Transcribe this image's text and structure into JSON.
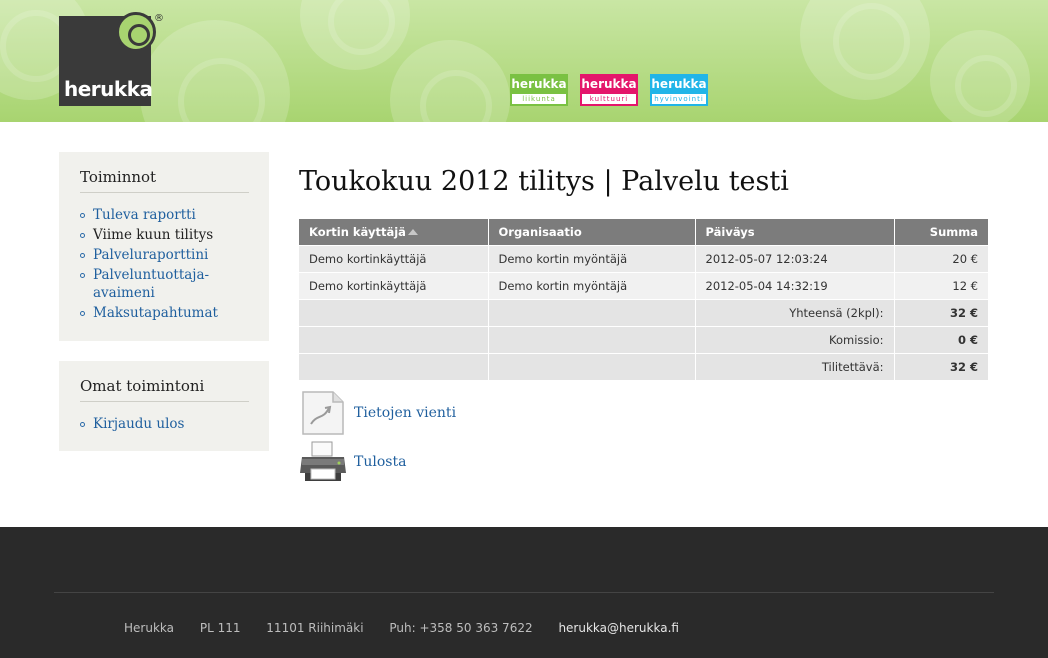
{
  "header": {
    "logo_text": "herukka",
    "logo_reg": "®",
    "brands": [
      {
        "name": "herukka",
        "sub": "liikunta",
        "color": "#7ac142"
      },
      {
        "name": "herukka",
        "sub": "kulttuuri",
        "color": "#e4166b"
      },
      {
        "name": "herukka",
        "sub": "hyvinvointi",
        "color": "#21b5e8"
      }
    ]
  },
  "sidebar": {
    "box1": {
      "title": "Toiminnot",
      "items": [
        {
          "label": "Tuleva raportti"
        },
        {
          "label": "Viime kuun tilitys"
        },
        {
          "label": "Palveluraporttini"
        },
        {
          "label": "Palveluntuottaja-avaimeni"
        },
        {
          "label": "Maksutapahtumat"
        }
      ]
    },
    "box2": {
      "title": "Omat toimintoni",
      "items": [
        {
          "label": "Kirjaudu ulos"
        }
      ]
    }
  },
  "main": {
    "title": "Toukokuu 2012 tilitys | Palvelu testi",
    "table": {
      "columns": [
        "Kortin käyttäjä",
        "Organisaatio",
        "Päiväys",
        "Summa"
      ],
      "rows": [
        [
          "Demo kortinkäyttäjä",
          "Demo kortin myöntäjä",
          "2012-05-07 12:03:24",
          "20 €"
        ],
        [
          "Demo kortinkäyttäjä",
          "Demo kortin myöntäjä",
          "2012-05-04 14:32:19",
          "12 €"
        ]
      ],
      "summary": [
        {
          "label": "Yhteensä (2kpl):",
          "value": "32 €"
        },
        {
          "label": "Komissio:",
          "value": "0 €"
        },
        {
          "label": "Tilitettävä:",
          "value": "32 €"
        }
      ]
    },
    "actions": {
      "export_label": "Tietojen vienti",
      "print_label": "Tulosta"
    }
  },
  "footer": {
    "name": "Herukka",
    "pobox": "PL 111",
    "city": "11101 Riihimäki",
    "phone": "Puh: +358 50 363 7622",
    "email": "herukka@herukka.fi"
  }
}
